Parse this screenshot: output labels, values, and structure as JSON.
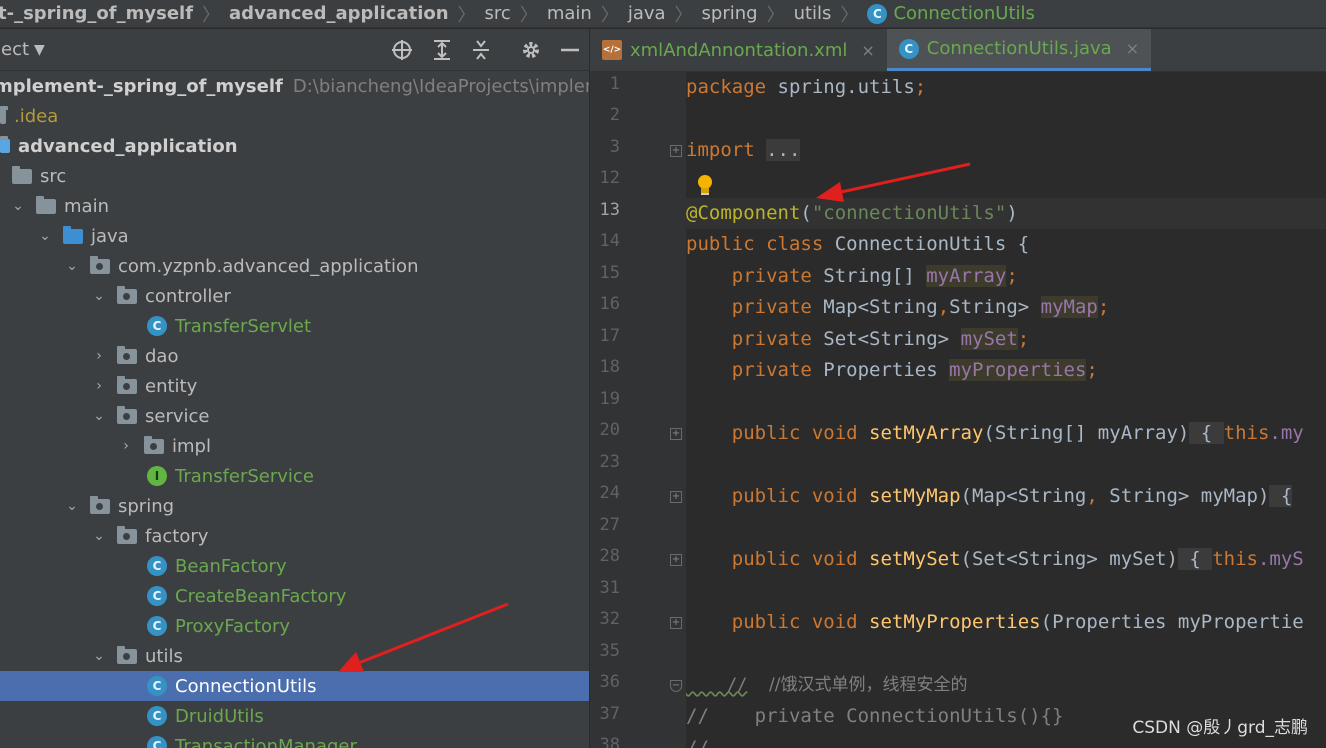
{
  "breadcrumb": {
    "items": [
      "t-_spring_of_myself",
      "advanced_application",
      "src",
      "main",
      "java",
      "spring",
      "utils",
      "ConnectionUtils"
    ]
  },
  "project": {
    "title": "ject",
    "toolbar_icons": [
      "locate-icon",
      "expand-all-icon",
      "collapse-all-icon",
      "gear-icon",
      "minimize-icon"
    ],
    "root_label": "mplement-_spring_of_myself",
    "root_path": "D:\\biancheng\\IdeaProjects\\implement",
    "tree": [
      {
        "label": ".idea"
      },
      {
        "label": "advanced_application"
      },
      {
        "label": "src"
      },
      {
        "label": "main"
      },
      {
        "label": "java"
      },
      {
        "label": "com.yzpnb.advanced_application"
      },
      {
        "label": "controller"
      },
      {
        "label": "TransferServlet"
      },
      {
        "label": "dao"
      },
      {
        "label": "entity"
      },
      {
        "label": "service"
      },
      {
        "label": "impl"
      },
      {
        "label": "TransferService"
      },
      {
        "label": "spring"
      },
      {
        "label": "factory"
      },
      {
        "label": "BeanFactory"
      },
      {
        "label": "CreateBeanFactory"
      },
      {
        "label": "ProxyFactory"
      },
      {
        "label": "utils"
      },
      {
        "label": "ConnectionUtils"
      },
      {
        "label": "DruidUtils"
      },
      {
        "label": "TransactionManager"
      }
    ]
  },
  "editor": {
    "tabs": [
      {
        "label": "xmlAndAnnontation.xml",
        "close": "×"
      },
      {
        "label": "ConnectionUtils.java",
        "close": "×"
      }
    ],
    "line_numbers": [
      "1",
      "2",
      "3",
      "12",
      "13",
      "14",
      "15",
      "16",
      "17",
      "18",
      "19",
      "20",
      "23",
      "24",
      "27",
      "28",
      "31",
      "32",
      "35",
      "36",
      "37",
      "38"
    ],
    "code": {
      "l1": [
        "package",
        " spring.utils",
        ";"
      ],
      "l3": [
        "import",
        " ",
        "..."
      ],
      "l13": [
        "@Component",
        "(",
        "\"connectionUtils\"",
        ")"
      ],
      "l14": [
        "public class",
        " ConnectionUtils {"
      ],
      "l15": [
        "    private",
        " String[] ",
        "myArray",
        ";"
      ],
      "l16": [
        "    private",
        " Map<String",
        ",",
        "String> ",
        "myMap",
        ";"
      ],
      "l17": [
        "    private",
        " Set<String> ",
        "mySet",
        ";"
      ],
      "l18": [
        "    private",
        " Properties ",
        "myProperties",
        ";"
      ],
      "l20": [
        "    public void ",
        "setMyArray",
        "(String[] myArray)",
        " { ",
        "this",
        ".my"
      ],
      "l24": [
        "    public void ",
        "setMyMap",
        "(Map<String",
        ",",
        " String> myMap)",
        " {"
      ],
      "l28": [
        "    public void ",
        "setMySet",
        "(Set<String> mySet)",
        " { ",
        "this",
        ".myS"
      ],
      "l32": [
        "    public void ",
        "setMyProperties",
        "(Properties myPropertie"
      ],
      "l36": [
        "    //",
        "    //饿汉式单例，线程安全的"
      ],
      "l37": [
        "//    private ConnectionUtils(){}"
      ],
      "l38": [
        "//"
      ]
    }
  },
  "watermark": "CSDN @殷丿grd_志鹏",
  "colors": {
    "keyword": "#cc7832",
    "annotation": "#bbb529",
    "string": "#6a8759",
    "field": "#9876aa",
    "method": "#ffc66d",
    "selection": "#4b6eaf",
    "arrow": "#e0201e"
  }
}
